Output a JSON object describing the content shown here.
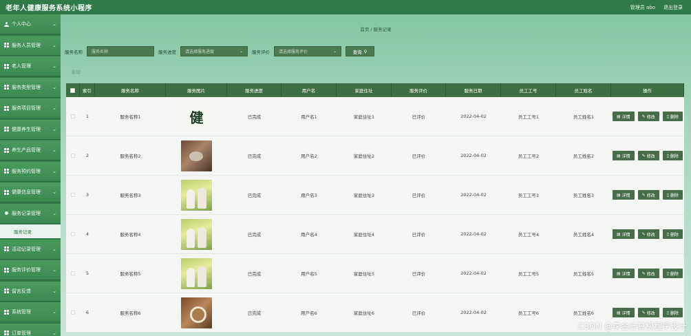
{
  "header": {
    "app_title": "老年人健康服务系统小程序",
    "admin_label": "管理员 abo",
    "logout_label": "退出登录"
  },
  "sidebar": {
    "items": [
      {
        "label": "个人中心",
        "icon": "user-icon"
      },
      {
        "label": "服务人员管理",
        "icon": "grid-icon"
      },
      {
        "label": "老人管理",
        "icon": "grid-icon"
      },
      {
        "label": "服务类型管理",
        "icon": "grid-icon"
      },
      {
        "label": "服务项目管理",
        "icon": "grid-icon"
      },
      {
        "label": "健康养生管理",
        "icon": "grid-icon"
      },
      {
        "label": "养生产品管理",
        "icon": "grid-icon"
      },
      {
        "label": "服务预约管理",
        "icon": "grid-icon"
      },
      {
        "label": "健康信息管理",
        "icon": "grid-icon"
      },
      {
        "label": "服务记录管理",
        "icon": "dot-icon"
      },
      {
        "label": "活动记录管理",
        "icon": "grid-icon"
      },
      {
        "label": "服务评价管理",
        "icon": "grid-icon"
      },
      {
        "label": "留言反馈",
        "icon": "grid-icon"
      },
      {
        "label": "系统管理",
        "icon": "grid-icon"
      },
      {
        "label": "订单管理",
        "icon": "grid-icon"
      }
    ],
    "submenu": {
      "label": "服务记录"
    }
  },
  "breadcrumb": {
    "home": "首页",
    "sep": "/",
    "current": "服务记录"
  },
  "filters": {
    "name_label": "服务名称",
    "name_placeholder": "服务名称",
    "progress_label": "服务进度",
    "progress_placeholder": "请选择服务进度",
    "evaluation_label": "服务评价",
    "evaluation_placeholder": "请选择服务评价",
    "query_label": "查询"
  },
  "actions": {
    "delete_label": "删除"
  },
  "table": {
    "headers": [
      "索引",
      "服务名称",
      "服务图片",
      "服务进度",
      "用户名",
      "家庭住址",
      "服务评价",
      "服务日期",
      "员工工号",
      "员工姓名",
      "操作"
    ],
    "op_labels": {
      "detail": "详情",
      "edit": "修改",
      "delete": "删除"
    },
    "rows": [
      {
        "idx": "1",
        "name": "服务名称1",
        "img": "calligraphy",
        "progress": "已完成",
        "user": "用户名1",
        "addr": "家庭住址1",
        "eval": "已评价",
        "date": "2022-04-02",
        "empno": "员工工号1",
        "empname": "员工姓名1"
      },
      {
        "idx": "2",
        "name": "服务名称2",
        "img": "brown",
        "progress": "已完成",
        "user": "用户名2",
        "addr": "家庭住址2",
        "eval": "已评价",
        "date": "2022-04-02",
        "empno": "员工工号2",
        "empname": "员工姓名2"
      },
      {
        "idx": "3",
        "name": "服务名称3",
        "img": "green",
        "progress": "已完成",
        "user": "用户名3",
        "addr": "家庭住址3",
        "eval": "已评价",
        "date": "2022-04-02",
        "empno": "员工工号3",
        "empname": "员工姓名3"
      },
      {
        "idx": "4",
        "name": "服务名称4",
        "img": "green",
        "progress": "已完成",
        "user": "用户名4",
        "addr": "家庭住址4",
        "eval": "已评价",
        "date": "2022-04-02",
        "empno": "员工工号4",
        "empname": "员工姓名4"
      },
      {
        "idx": "5",
        "name": "服务名称5",
        "img": "green",
        "progress": "已完成",
        "user": "用户名5",
        "addr": "家庭住址5",
        "eval": "已评价",
        "date": "2022-04-02",
        "empno": "员工工号5",
        "empname": "员工姓名5"
      },
      {
        "idx": "6",
        "name": "服务名称6",
        "img": "tea",
        "progress": "已完成",
        "user": "用户名6",
        "addr": "家庭住址6",
        "eval": "已评价",
        "date": "2022-04-02",
        "empno": "员工工号6",
        "empname": "员工姓名6"
      }
    ]
  },
  "watermark": "CSDN @李会计算机程序设计"
}
